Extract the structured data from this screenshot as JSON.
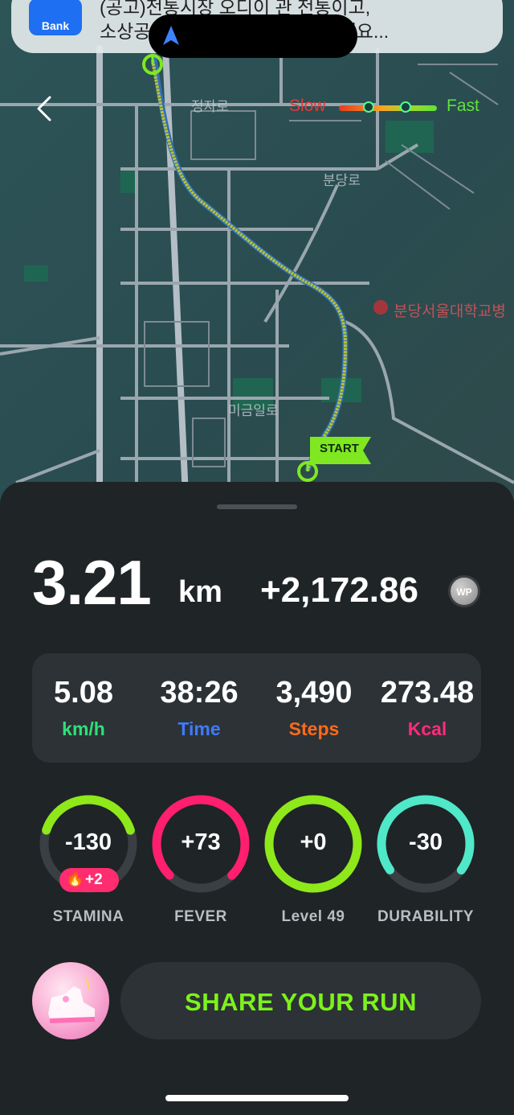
{
  "notification": {
    "app_name": "Bank",
    "text_line1": "(공고)전통시장 오디이 관 전통이고,",
    "text_line2": "소상공인 온라인 판매 ... 확인하세요..."
  },
  "map": {
    "speed_slow": "Slow",
    "speed_fast": "Fast",
    "start_label": "START",
    "place_labels": [
      "정자로",
      "분당서울대학교병",
      "분당로",
      "미금일로"
    ]
  },
  "summary": {
    "distance_value": "3.21",
    "distance_unit": "km",
    "wp_value": "+2,172.86",
    "wp_icon_text": "WP"
  },
  "stats": [
    {
      "value": "5.08",
      "label": "km/h",
      "color": "#2ee07a"
    },
    {
      "value": "38:26",
      "label": "Time",
      "color": "#3d7bff"
    },
    {
      "value": "3,490",
      "label": "Steps",
      "color": "#ff6a1a"
    },
    {
      "value": "273.48",
      "label": "Kcal",
      "color": "#ff2b7a"
    }
  ],
  "rings": [
    {
      "value": "-130",
      "label": "STAMINA",
      "color": "#8ee81a",
      "fraction": 0.4
    },
    {
      "value": "+73",
      "label": "FEVER",
      "color": "#ff1f6d",
      "fraction": 0.75
    },
    {
      "value": "+0",
      "label": "Level 49",
      "color": "#8ee81a",
      "fraction": 1.0
    },
    {
      "value": "-30",
      "label": "DURABILITY",
      "color": "#4fe8c8",
      "fraction": 0.7
    }
  ],
  "stamina_bonus": "+2",
  "share_button": "SHARE YOUR RUN",
  "colors": {
    "route": "#b7c23a",
    "background": "#1f2426",
    "accent": "#7cf21b"
  }
}
